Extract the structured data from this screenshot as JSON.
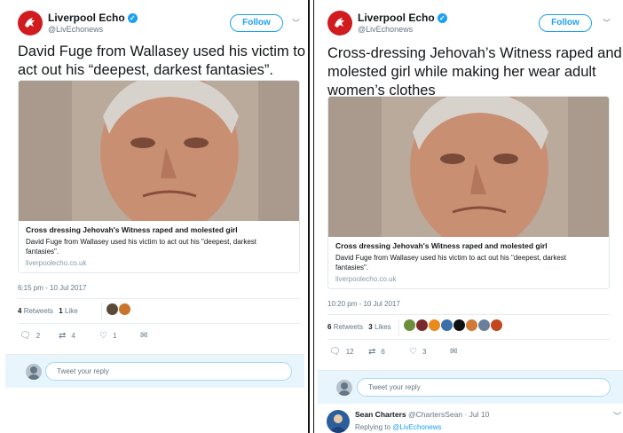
{
  "left": {
    "account_name": "Liverpool Echo",
    "handle": "@LivEchonews",
    "follow_label": "Follow",
    "tweet_text_line1": "David Fuge from Wallasey used his victim to",
    "tweet_text_line2": "act out his “deepest, darkest fantasies”.",
    "card": {
      "title": "Cross dressing Jehovah's Witness raped and molested girl",
      "desc_line1": "David Fuge from Wallasey used his victim to act out his \"deepest, darkest",
      "desc_line2": "fantasies\".",
      "url": "liverpoolecho.co.uk"
    },
    "timestamp": "6:15 pm - 10 Jul 2017",
    "retweets_count": "4",
    "retweets_label": "Retweets",
    "likes_count": "1",
    "likes_label": "Like",
    "actions": {
      "replies": "2",
      "retweets": "4",
      "likes": "1"
    },
    "reply_placeholder": "Tweet your reply"
  },
  "right": {
    "account_name": "Liverpool Echo",
    "handle": "@LivEchonews",
    "follow_label": "Follow",
    "tweet_text_line1": "Cross-dressing Jehovah’s Witness raped and",
    "tweet_text_line2": "molested girl while making her wear adult",
    "tweet_text_line3": "women’s clothes",
    "card": {
      "title": "Cross dressing Jehovah's Witness raped and molested girl",
      "desc_line1": "David Fuge from Wallasey used his victim to act out his \"deepest, darkest",
      "desc_line2": "fantasies\".",
      "url": "liverpoolecho.co.uk"
    },
    "timestamp": "10:20 pm - 10 Jul 2017",
    "retweets_count": "6",
    "retweets_label": "Retweets",
    "likes_count": "3",
    "likes_label": "Likes",
    "actions": {
      "replies": "12",
      "retweets": "6",
      "likes": "3"
    },
    "reply_placeholder": "Tweet your reply",
    "reply": {
      "name": "Sean Charters",
      "handle_date": "@ChartersSean · Jul 10",
      "replying_prefix": "Replying to",
      "replying_to": "@LivEchonews"
    }
  },
  "colors": {
    "brand": "#d01c1f",
    "accent": "#1da1f2",
    "muted": "#657786",
    "text": "#14171a"
  },
  "icons": [
    "verified-badge-icon",
    "reply-icon",
    "retweet-icon",
    "like-icon",
    "message-icon",
    "chevron-down-icon"
  ]
}
